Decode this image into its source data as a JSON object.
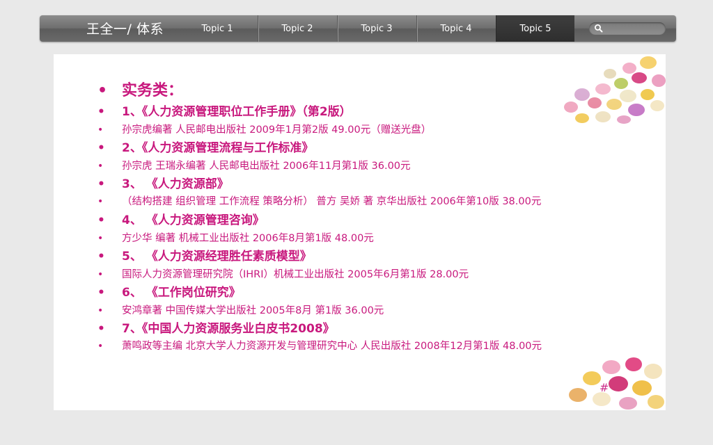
{
  "nav": {
    "title": "王全一/ 体系",
    "tabs": [
      "Topic 1",
      "Topic 2",
      "Topic 3",
      "Topic 4",
      "Topic 5"
    ],
    "active_tab": "Topic 5"
  },
  "slide": {
    "heading": "实务类：",
    "books": [
      {
        "title": "1、《人力资源管理职位工作手册》（第2版）",
        "detail": "孙宗虎编著 人民邮电出版社 2009年1月第2版 49.00元（赠送光盘）"
      },
      {
        "title": "2、《人力资源管理流程与工作标准》",
        "detail": "孙宗虎 王瑞永编著 人民邮电出版社 2006年11月第1版 36.00元"
      },
      {
        "title": "3、 《人力资源部》",
        "detail": "（结构搭建 组织管理 工作流程 策略分析） 普方 吴娇 著 京华出版社 2006年第10版 38.00元"
      },
      {
        "title": "4、 《人力资源管理咨询》",
        "detail": "方少华 编著 机械工业出版社 2006年8月第1版 48.00元"
      },
      {
        "title": "5、 《人力资源经理胜任素质模型》",
        "detail": "国际人力资源管理研究院（IHRI）机械工业出版社 2005年6月第1版 28.00元"
      },
      {
        "title": "6、 《工作岗位研究》",
        "detail": "安鸿章著 中国传媒大学出版社 2005年8月 第1版 36.00元"
      },
      {
        "title": "7、《中国人力资源服务业白皮书2008》",
        "detail": "萧鸣政等主编 北京大学人力资源开发与管理研究中心 人民出版社 2008年12月第1版 48.00元"
      }
    ],
    "page_number": "#"
  },
  "colors": {
    "accent": "#c8187d",
    "nav_bar": "#6f6f6f",
    "active_tab": "#333333"
  }
}
